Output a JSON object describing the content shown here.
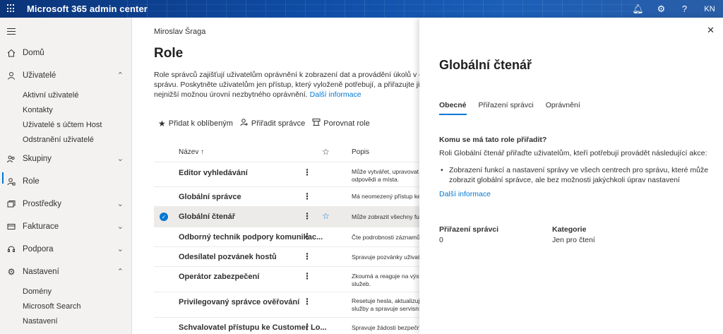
{
  "app": {
    "title": "Microsoft 365 admin center",
    "avatar": "KN"
  },
  "nav": {
    "items": [
      {
        "label": "Domů",
        "icon": "home-icon"
      },
      {
        "label": "Uživatelé",
        "icon": "person-icon",
        "expanded": true
      },
      {
        "label": "Skupiny",
        "icon": "group-icon"
      },
      {
        "label": "Role",
        "icon": "role-icon",
        "active": true
      },
      {
        "label": "Prostředky",
        "icon": "resources-icon"
      },
      {
        "label": "Fakturace",
        "icon": "billing-icon"
      },
      {
        "label": "Podpora",
        "icon": "headset-icon"
      },
      {
        "label": "Nastavení",
        "icon": "gear-icon",
        "expanded": true
      }
    ],
    "users_sub": [
      "Aktivní uživatelé",
      "Kontakty",
      "Uživatelé s účtem Host",
      "Odstranění uživatelé"
    ],
    "settings_sub": [
      "Domény",
      "Microsoft Search",
      "Nastavení"
    ]
  },
  "main": {
    "org": "Miroslav Šraga",
    "title": "Role",
    "desc_line1": "Role správců zajišťují uživatelům oprávnění k zobrazení dat a provádění úkolů v centrech pro",
    "desc_line2": "správu. Poskytněte uživatelům jen přístup, který vyloženě potřebují, a přiřazujte jim role s",
    "desc_line3": "nejnižší možnou úrovní nezbytného oprávnění.",
    "desc_link": "Další informace",
    "toolbar": {
      "favorite": "Přidat k oblíbeným",
      "assign": "Přiřadit správce",
      "compare": "Porovnat role"
    },
    "columns": {
      "name": "Název ↑",
      "desc": "Popis"
    },
    "rows": [
      {
        "name": "Editor vyhledávání",
        "desc": "Může vytvářet, upravovat a odpovědi a místa."
      },
      {
        "name": "Globální správce",
        "desc": "Má neomezený přístup ke v"
      },
      {
        "name": "Globální čtenář",
        "desc": "Může zobrazit všechny funk",
        "selected": true
      },
      {
        "name": "Odborný technik podpory komunikac...",
        "desc": "Čte podrobnosti záznamů c"
      },
      {
        "name": "Odesílatel pozvánek hostů",
        "desc": "Spravuje pozvánky uživatel"
      },
      {
        "name": "Operátor zabezpečení",
        "desc": "Zkoumá a reaguje na výstra služeb."
      },
      {
        "name": "Privilegovaný správce ověřování",
        "desc": "Resetuje hesla, aktualizuje p služby a spravuje servisní po"
      },
      {
        "name": "Schvalovatel přístupu ke Customer Lo...",
        "desc": "Spravuje žádosti bezpečnos"
      }
    ]
  },
  "panel": {
    "title": "Globální čtenář",
    "tabs": [
      "Obecné",
      "Přiřazení správci",
      "Oprávnění"
    ],
    "q_title": "Komu se má tato role přiřadit?",
    "q_text": "Roli Globální čtenář přiřaďte uživatelům, kteří potřebují provádět následující akce:",
    "bullet": "Zobrazení funkcí a nastavení správy ve všech centrech pro správu, které může zobrazit globální správce, ale bez možnosti jakýchkoli úprav nastavení",
    "more_link": "Další informace",
    "assigned_label": "Přiřazení správci",
    "assigned_value": "0",
    "category_label": "Kategorie",
    "category_value": "Jen pro čtení"
  }
}
